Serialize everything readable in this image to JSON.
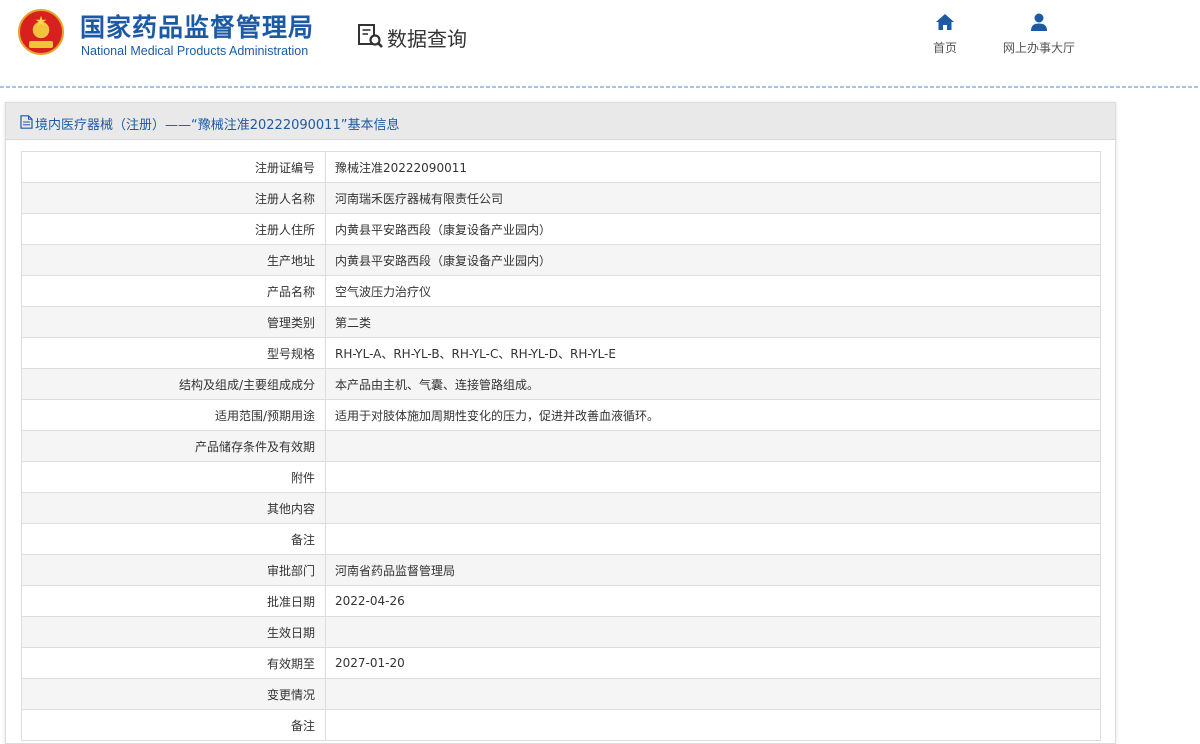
{
  "header": {
    "org_name_cn": "国家药品监督管理局",
    "org_name_en": "National Medical Products Administration",
    "section_title": "数据查询",
    "nav": [
      {
        "label": "首页",
        "icon": "home-icon"
      },
      {
        "label": "网上办事大厅",
        "icon": "user-icon"
      }
    ]
  },
  "panel": {
    "title": "境内医疗器械（注册）——“豫械注准20222090011”基本信息",
    "rows": [
      {
        "label": "注册证编号",
        "value": "豫械注准20222090011"
      },
      {
        "label": "注册人名称",
        "value": "河南瑞禾医疗器械有限责任公司"
      },
      {
        "label": "注册人住所",
        "value": "内黄县平安路西段（康复设备产业园内）"
      },
      {
        "label": "生产地址",
        "value": "内黄县平安路西段（康复设备产业园内）"
      },
      {
        "label": "产品名称",
        "value": "空气波压力治疗仪"
      },
      {
        "label": "管理类别",
        "value": "第二类"
      },
      {
        "label": "型号规格",
        "value": "RH-YL-A、RH-YL-B、RH-YL-C、RH-YL-D、RH-YL-E"
      },
      {
        "label": "结构及组成/主要组成成分",
        "value": "本产品由主机、气囊、连接管路组成。"
      },
      {
        "label": "适用范围/预期用途",
        "value": "适用于对肢体施加周期性变化的压力，促进并改善血液循环。"
      },
      {
        "label": "产品储存条件及有效期",
        "value": ""
      },
      {
        "label": "附件",
        "value": ""
      },
      {
        "label": "其他内容",
        "value": ""
      },
      {
        "label": "备注",
        "value": ""
      },
      {
        "label": "审批部门",
        "value": "河南省药品监督管理局"
      },
      {
        "label": "批准日期",
        "value": "2022-04-26"
      },
      {
        "label": "生效日期",
        "value": ""
      },
      {
        "label": "有效期至",
        "value": "2027-01-20"
      },
      {
        "label": "变更情况",
        "value": ""
      },
      {
        "label": "备注",
        "value": ""
      }
    ]
  },
  "colors": {
    "brand_blue": "#1d5aa6",
    "title_bar": "#e9e9e9",
    "row_alt": "#f5f5f5",
    "border": "#dddddd"
  }
}
